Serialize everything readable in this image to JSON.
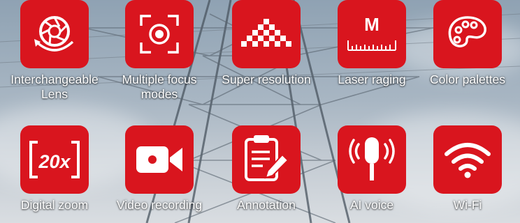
{
  "features": [
    {
      "icon": "interchangeable-lens-icon",
      "label": "Interchangeable Lens"
    },
    {
      "icon": "focus-target-icon",
      "label": "Multiple focus modes"
    },
    {
      "icon": "pixel-triangle-icon",
      "label": "Super resolution"
    },
    {
      "icon": "laser-ruler-icon",
      "label": "Laser raging",
      "icon_text": "M"
    },
    {
      "icon": "palette-icon",
      "label": "Color palettes"
    },
    {
      "icon": "zoom-20x-icon",
      "label": "Digital zoom",
      "icon_text": "20x"
    },
    {
      "icon": "video-camera-icon",
      "label": "Video recording"
    },
    {
      "icon": "clipboard-pen-icon",
      "label": "Annotation"
    },
    {
      "icon": "microphone-icon",
      "label": "AI voice"
    },
    {
      "icon": "wifi-icon",
      "label": "Wi-Fi"
    }
  ],
  "colors": {
    "tile": "#d9151e",
    "label": "#ffffff"
  }
}
